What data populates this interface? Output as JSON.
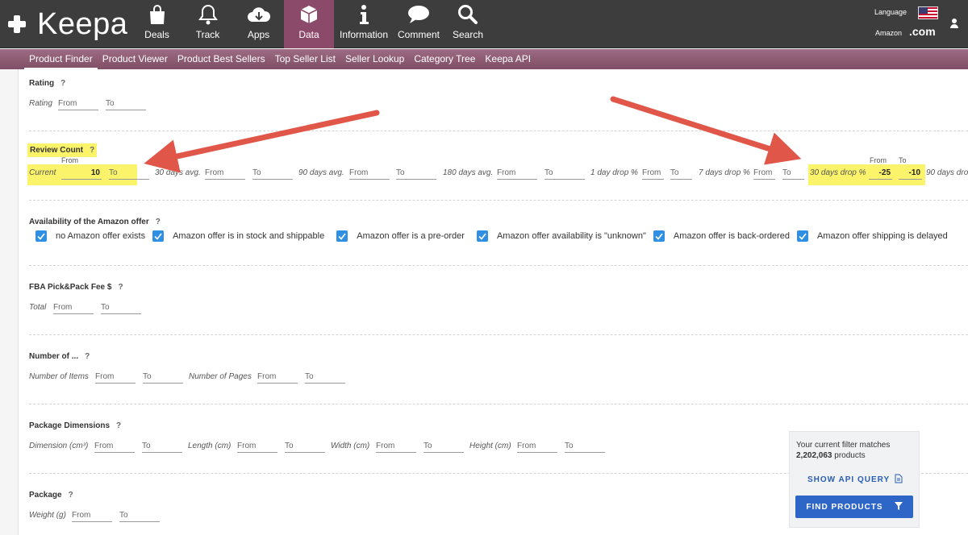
{
  "brand": {
    "name": "Keepa"
  },
  "nav": [
    {
      "label": "Deals",
      "icon": "bag-icon"
    },
    {
      "label": "Track",
      "icon": "bell-icon"
    },
    {
      "label": "Apps",
      "icon": "cloud-download-icon"
    },
    {
      "label": "Data",
      "icon": "cube-icon",
      "active": true
    },
    {
      "label": "Information",
      "icon": "info-icon"
    },
    {
      "label": "Comment",
      "icon": "speech-bubble-icon"
    },
    {
      "label": "Search",
      "icon": "search-icon"
    }
  ],
  "header_right": {
    "language_label": "Language",
    "amazon_label": "Amazon",
    "domain": ".com"
  },
  "subnav": [
    "Product Finder",
    "Product Viewer",
    "Product Best Sellers",
    "Top Seller List",
    "Seller Lookup",
    "Category Tree",
    "Keepa API"
  ],
  "rating": {
    "title": "Rating",
    "q": "?",
    "label": "Rating",
    "from": "From",
    "to": "To"
  },
  "review_count": {
    "title": "Review Count",
    "q": "?",
    "current_label": "Current",
    "from_top": "From",
    "current_value": "10",
    "current_to": "To",
    "d30_label": "30 days avg.",
    "d90_label": "90 days avg.",
    "d180_label": "180 days avg.",
    "drop1_label": "1 day drop %",
    "drop7_label": "7 days drop %",
    "drop30_label": "30 days drop %",
    "drop30_from_top": "From",
    "drop30_to_top": "To",
    "drop30_from_value": "-25",
    "drop30_to_value": "-10",
    "drop90_label": "90 days drop",
    "from": "From",
    "to": "To"
  },
  "availability": {
    "title": "Availability of the Amazon offer",
    "q": "?",
    "options": [
      {
        "label": "no Amazon offer exists",
        "checked": true
      },
      {
        "label": "Amazon offer is in stock and shippable",
        "checked": true
      },
      {
        "label": "Amazon offer is a pre-order",
        "checked": true
      },
      {
        "label": "Amazon offer availability is \"unknown\"",
        "checked": true
      },
      {
        "label": "Amazon offer is back-ordered",
        "checked": true
      },
      {
        "label": "Amazon offer shipping is delayed",
        "checked": true
      }
    ]
  },
  "fba": {
    "title": "FBA Pick&Pack Fee $",
    "q": "?",
    "label": "Total",
    "from": "From",
    "to": "To"
  },
  "number_of": {
    "title": "Number of ...",
    "q": "?",
    "items_label": "Number of Items",
    "pages_label": "Number of Pages",
    "from": "From",
    "to": "To"
  },
  "package_dimensions": {
    "title": "Package Dimensions",
    "q": "?",
    "dimension_label": "Dimension (cm³)",
    "length_label": "Length (cm)",
    "width_label": "Width (cm)",
    "height_label": "Height (cm)",
    "from": "From",
    "to": "To"
  },
  "package": {
    "title": "Package",
    "q": "?",
    "weight_label": "Weight (g)",
    "from": "From",
    "to": "To"
  },
  "results_panel": {
    "line1": "Your current filter matches",
    "count": "2,202,063",
    "count_suffix": " products",
    "api_label": "SHOW API QUERY",
    "find_label": "FIND PRODUCTS"
  },
  "colors": {
    "topbar": "#3d3d3d",
    "active_nav": "#8c4a6a",
    "subnav": "#8f5c74",
    "highlight": "#fbf46b",
    "checkbox": "#2f8fe2",
    "button": "#2e66c8",
    "arrow": "#e0574a"
  }
}
